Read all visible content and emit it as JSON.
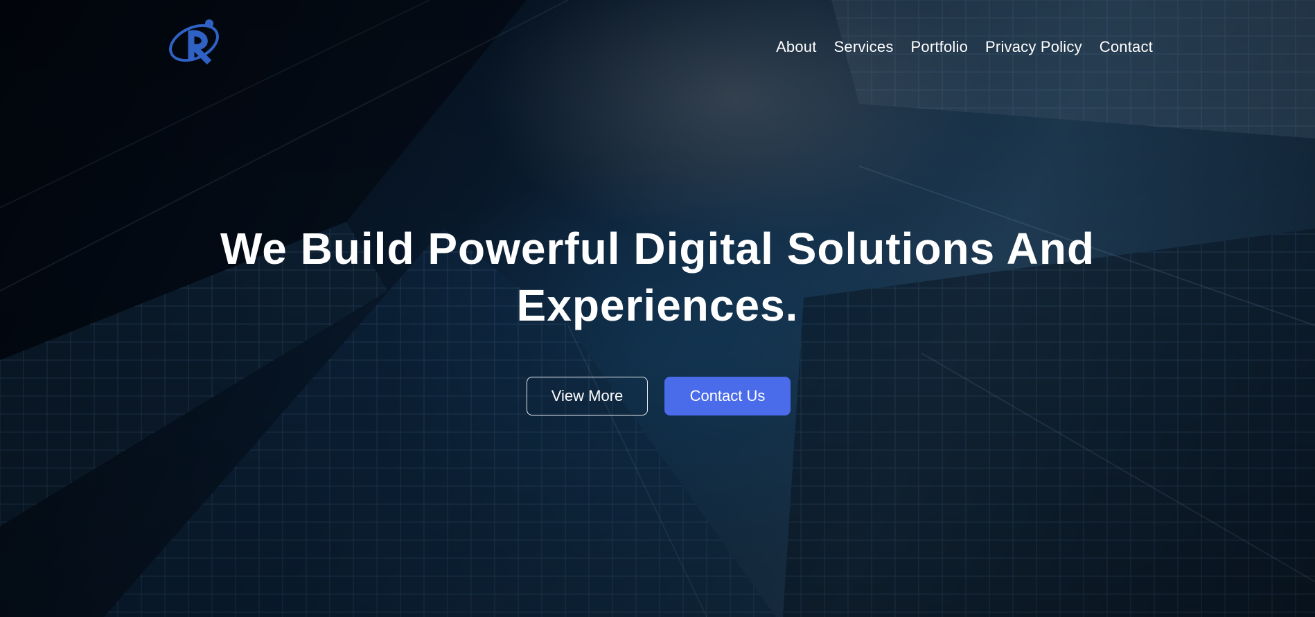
{
  "nav": {
    "items": [
      "About",
      "Services",
      "Portfolio",
      "Privacy Policy",
      "Contact"
    ]
  },
  "hero": {
    "headline_line1": "We Build Powerful Digital Solutions And",
    "headline_line2": "Experiences.",
    "view_more_label": "View More",
    "contact_us_label": "Contact Us"
  },
  "colors": {
    "accent": "#4a6bea",
    "logo_blue": "#2f62c4",
    "text": "#ffffff"
  },
  "icons": {
    "logo": "company-logo-icon"
  }
}
